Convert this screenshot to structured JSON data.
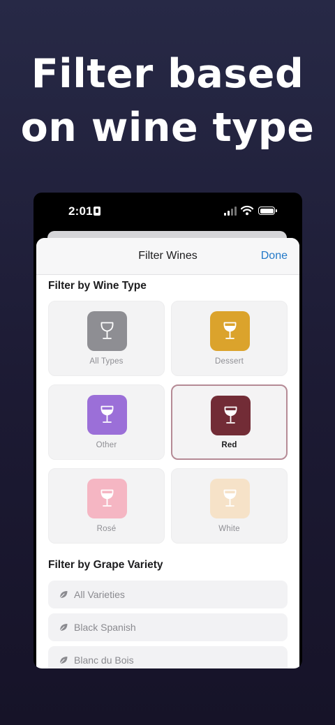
{
  "headline": {
    "line1": "Filter based",
    "line2": "on wine type"
  },
  "status_bar": {
    "time": "2:01"
  },
  "sheet": {
    "title": "Filter Wines",
    "done_label": "Done",
    "wine_type_section": "Filter by Wine Type",
    "grape_section": "Filter by Grape Variety"
  },
  "wine_types": [
    {
      "label": "All Types",
      "color": "#8e8e93",
      "selected": false
    },
    {
      "label": "Dessert",
      "color": "#dba32c",
      "selected": false
    },
    {
      "label": "Other",
      "color": "#9b6fd8",
      "selected": false
    },
    {
      "label": "Red",
      "color": "#722c36",
      "selected": true
    },
    {
      "label": "Rosé",
      "color": "#f5b6c3",
      "selected": false
    },
    {
      "label": "White",
      "color": "#f6e2c8",
      "selected": false
    }
  ],
  "grape_varieties": [
    {
      "label": "All Varieties",
      "icon": "leaf-icon"
    },
    {
      "label": "Black Spanish",
      "icon": "leaf-icon"
    },
    {
      "label": "Blanc du Bois",
      "icon": "leaf-icon"
    }
  ],
  "icons": {
    "wine_type": "wine-glass-icon",
    "variety": "leaf-icon"
  }
}
